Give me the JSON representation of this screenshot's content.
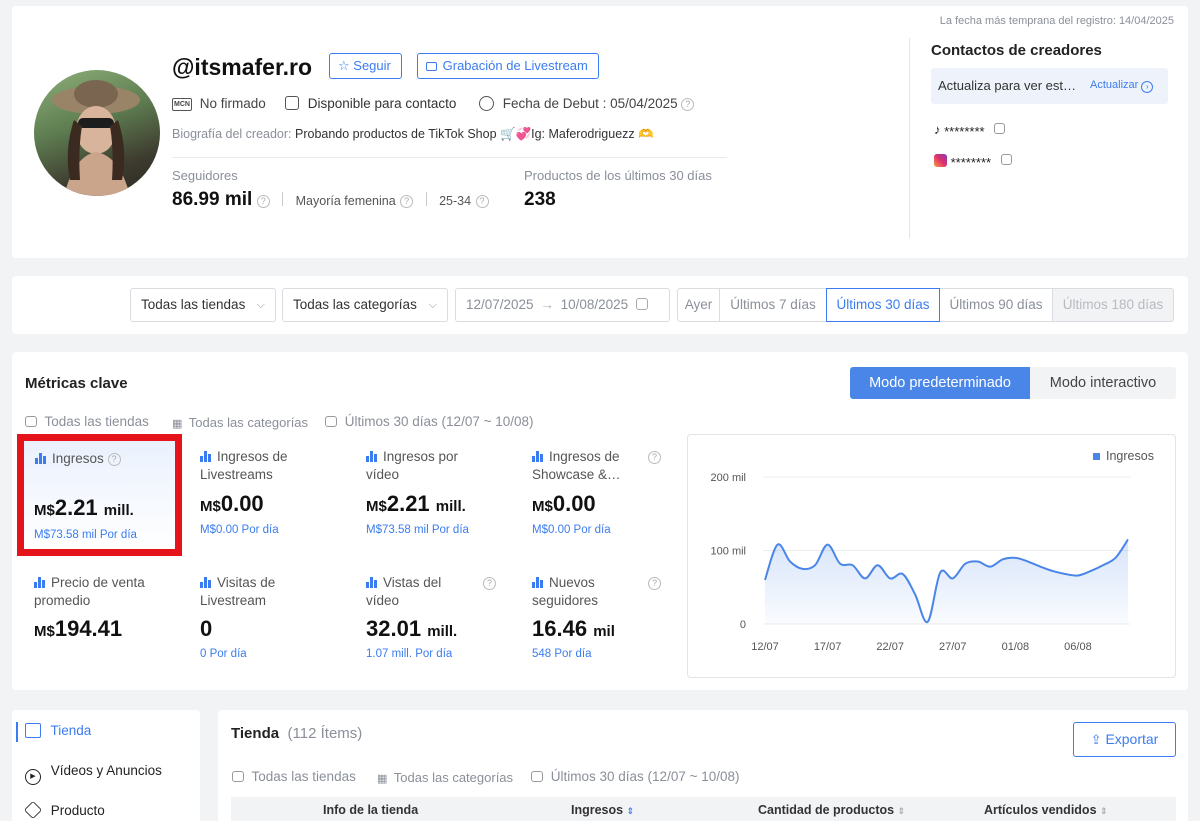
{
  "profile": {
    "earliest_record": "La fecha más temprana del registro: 14/04/2025",
    "handle": "@itsmafer.ro",
    "follow_label": "Seguir",
    "livestream_label": "Grabación de Livestream",
    "mcn_badge": "MCN",
    "mcn_status": "No firmado",
    "contact_status": "Disponible para contacto",
    "debut": "Fecha de Debut : 05/04/2025",
    "bio_label": "Biografía del creador:",
    "bio_text": "Probando productos de TikTok Shop 🛒💞Ig: Maferodriguezz 🫶",
    "followers_label": "Seguidores",
    "followers_value": "86.99 mil",
    "gender": "Mayoría femenina",
    "age": "25-34",
    "products_label": "Productos de los últimos 30 días",
    "products_value": "238"
  },
  "contacts": {
    "title": "Contactos de creadores",
    "update_text": "Actualiza para ver est…",
    "update_button": "Actualizar",
    "tiktok_masked": "********",
    "instagram_masked": "********"
  },
  "filters": {
    "stores": "Todas las tiendas",
    "categories": "Todas las categorías",
    "date_from": "12/07/2025",
    "date_to": "10/08/2025",
    "periods": [
      "Ayer",
      "Últimos 7 días",
      "Últimos 30 días",
      "Últimos 90 días",
      "Últimos 180 días"
    ]
  },
  "metrics": {
    "title": "Métricas clave",
    "mode_default": "Modo predeterminado",
    "mode_interactive": "Modo interactivo",
    "filter_stores": "Todas las tiendas",
    "filter_categories": "Todas las categorías",
    "filter_period": "Últimos 30 días (12/07 ~ 10/08)",
    "cards": [
      {
        "title": "Ingresos",
        "currency": "M$",
        "value": "2.21",
        "unit": "mill.",
        "sub": "M$73.58 mil Por día"
      },
      {
        "title": "Ingresos de Livestreams",
        "currency": "M$",
        "value": "0.00",
        "unit": "",
        "sub": "M$0.00 Por día"
      },
      {
        "title": "Ingresos por vídeo",
        "currency": "M$",
        "value": "2.21",
        "unit": "mill.",
        "sub": "M$73.58 mil Por día"
      },
      {
        "title": "Ingresos de Showcase &…",
        "currency": "M$",
        "value": "0.00",
        "unit": "",
        "sub": "M$0.00 Por día"
      },
      {
        "title": "Precio de venta promedio",
        "currency": "M$",
        "value": "194.41",
        "unit": "",
        "sub": ""
      },
      {
        "title": "Visitas de Livestream",
        "currency": "",
        "value": "0",
        "unit": "",
        "sub": "0 Por día"
      },
      {
        "title": "Vistas del vídeo",
        "currency": "",
        "value": "32.01",
        "unit": "mill.",
        "sub": "1.07 mill. Por día"
      },
      {
        "title": "Nuevos seguidores",
        "currency": "",
        "value": "16.46",
        "unit": "mil",
        "sub": "548 Por día"
      }
    ]
  },
  "chart_data": {
    "type": "area",
    "legend": "Ingresos",
    "legend_position": "top-right",
    "y_ticks": [
      "200 mil",
      "100 mil",
      "0"
    ],
    "ylim": [
      0,
      200
    ],
    "x_ticks": [
      "12/07",
      "17/07",
      "22/07",
      "27/07",
      "01/08",
      "06/08"
    ],
    "x": [
      "12/07",
      "13/07",
      "14/07",
      "15/07",
      "16/07",
      "17/07",
      "18/07",
      "19/07",
      "20/07",
      "21/07",
      "22/07",
      "23/07",
      "24/07",
      "25/07",
      "26/07",
      "27/07",
      "28/07",
      "29/07",
      "30/07",
      "31/07",
      "01/08",
      "02/08",
      "03/08",
      "04/08",
      "05/08",
      "06/08",
      "07/08",
      "08/08",
      "09/08",
      "10/08"
    ],
    "values": [
      60,
      108,
      85,
      75,
      80,
      108,
      82,
      80,
      62,
      80,
      62,
      68,
      40,
      3,
      70,
      62,
      82,
      85,
      78,
      88,
      90,
      85,
      78,
      72,
      68,
      66,
      72,
      80,
      90,
      115
    ],
    "color": "#4a86e8"
  },
  "store": {
    "nav": [
      "Tienda",
      "Vídeos y Anuncios",
      "Producto"
    ],
    "title": "Tienda",
    "count": "(112 Ítems)",
    "export_label": "Exportar",
    "filter_stores": "Todas las tiendas",
    "filter_categories": "Todas las categorías",
    "filter_period": "Últimos 30 días (12/07 ~ 10/08)",
    "columns": [
      "Info de la tienda",
      "Ingresos",
      "Cantidad de productos",
      "Artículos vendidos"
    ]
  }
}
